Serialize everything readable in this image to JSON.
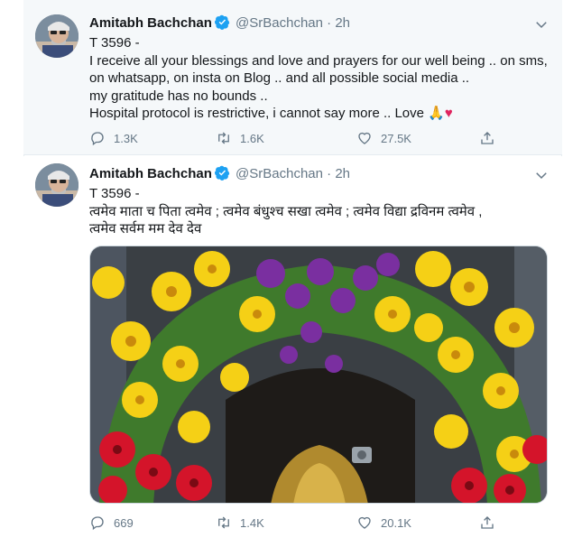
{
  "colors": {
    "verified": "#1da1f2",
    "heart": "#e0245e",
    "muted": "#657786",
    "highlight_bg": "#f5f8fa"
  },
  "tweets": [
    {
      "author_name": "Amitabh Bachchan",
      "handle": "@SrBachchan",
      "separator": "·",
      "time": "2h",
      "lines": [
        "T 3596 -",
        "I receive all your blessings and love and prayers for our well being .. on sms,",
        "on whatsapp, on insta on Blog .. and all possible social media ..",
        "my gratitude has no bounds ..",
        "Hospital protocol is restrictive, i cannot say more .. Love"
      ],
      "emojis": [
        "🙏",
        "♥"
      ],
      "replies": "1.3K",
      "retweets": "1.6K",
      "likes": "27.5K"
    },
    {
      "author_name": "Amitabh Bachchan",
      "handle": "@SrBachchan",
      "separator": "·",
      "time": "2h",
      "lines": [
        "T 3596 -",
        " त्वमेव माता च पिता त्वमेव ; त्वमेव बंधुश्च सखा त्वमेव ; त्वमेव विद्या द्रविनम  त्वमेव ,",
        "त्वमेव सर्वम मम देव देव"
      ],
      "replies": "669",
      "retweets": "1.4K",
      "likes": "20.1K"
    }
  ],
  "icons": {
    "verified": "verified-badge-icon",
    "caret": "chevron-down-icon",
    "reply": "reply-icon",
    "retweet": "retweet-icon",
    "like": "heart-outline-icon",
    "share": "share-icon"
  }
}
